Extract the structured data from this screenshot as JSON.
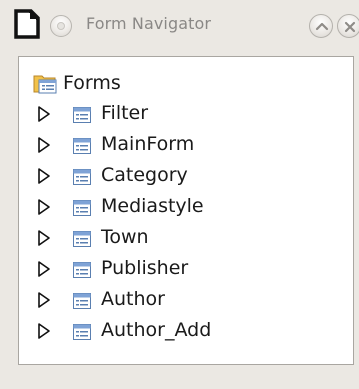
{
  "window": {
    "title": "Form Navigator"
  },
  "icons": {
    "app": "document-icon",
    "menu": "window-menu-icon",
    "rollup": "chevron-up-icon",
    "close": "close-icon",
    "folder": "forms-folder-icon",
    "form": "form-icon",
    "expander": "expand-triangle-icon"
  },
  "tree": {
    "root_label": "Forms",
    "items": [
      {
        "label": "Filter"
      },
      {
        "label": "MainForm"
      },
      {
        "label": "Category"
      },
      {
        "label": "Mediastyle"
      },
      {
        "label": "Town"
      },
      {
        "label": "Publisher"
      },
      {
        "label": "Author"
      },
      {
        "label": "Author_Add"
      }
    ]
  }
}
